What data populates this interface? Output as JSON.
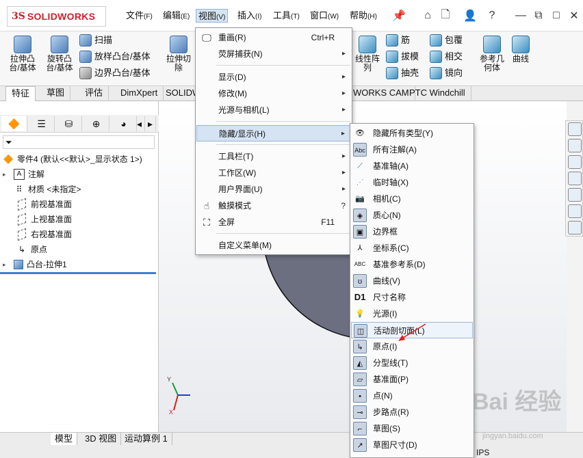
{
  "app": {
    "logo_ds": "3S",
    "logo_brand": "SOLIDWORKS"
  },
  "menubar": [
    {
      "label": "文件",
      "key": "(F)"
    },
    {
      "label": "编辑",
      "key": "(E)"
    },
    {
      "label": "视图",
      "key": "(V)"
    },
    {
      "label": "插入",
      "key": "(I)"
    },
    {
      "label": "工具",
      "key": "(T)"
    },
    {
      "label": "窗口",
      "key": "(W)"
    },
    {
      "label": "帮助",
      "key": "(H)"
    }
  ],
  "command_manager": {
    "extrude_boss": "拉伸凸\n台/基体",
    "revolve_boss": "旋转凸\n台/基体",
    "sweep": "扫描",
    "loft": "放样凸台/基体",
    "boundary": "边界凸台/基体",
    "extrude_cut": "拉伸切\n除",
    "linear_pattern": "线性阵\n列",
    "rib": "筋",
    "draft": "拔模",
    "shell": "抽壳",
    "wrap": "包覆",
    "intersect": "相交",
    "mirror": "镜向",
    "ref_geometry": "参考几\n何体",
    "curves": "曲线"
  },
  "tabs": [
    "特征",
    "草图",
    "评估",
    "DimXpert",
    "SOLIDW",
    "WORKS CAM",
    "PTC Windchill"
  ],
  "tree": {
    "part": "零件4 (默认<<默认>_显示状态 1>)",
    "items": [
      "注解",
      "材质 <未指定>",
      "前视基准面",
      "上视基准面",
      "右视基准面",
      "原点",
      "凸台-拉伸1"
    ]
  },
  "view_menu": [
    {
      "label": "重画(R)",
      "shortcut": "Ctrl+R",
      "submenu": false
    },
    {
      "label": "荧屏捕获(N)",
      "shortcut": "",
      "submenu": true
    },
    {
      "label": "显示(D)",
      "shortcut": "",
      "submenu": true
    },
    {
      "label": "修改(M)",
      "shortcut": "",
      "submenu": true
    },
    {
      "label": "光源与相机(L)",
      "shortcut": "",
      "submenu": true
    },
    {
      "label": "隐藏/显示(H)",
      "shortcut": "",
      "submenu": true
    },
    {
      "label": "工具栏(T)",
      "shortcut": "",
      "submenu": true
    },
    {
      "label": "工作区(W)",
      "shortcut": "",
      "submenu": true
    },
    {
      "label": "用户界面(U)",
      "shortcut": "",
      "submenu": true
    },
    {
      "label": "触摸模式",
      "shortcut": "",
      "submenu": false
    },
    {
      "label": "全屏",
      "shortcut": "F11",
      "submenu": false
    },
    {
      "label": "自定义菜单(M)",
      "shortcut": "",
      "submenu": false
    }
  ],
  "hide_show_menu": [
    {
      "label": "隐藏所有类型(Y)",
      "icon": "eye-icon"
    },
    {
      "label": "所有注解(A)",
      "icon": "annotation-icon",
      "icon_text": "Abc"
    },
    {
      "label": "基准轴(A)",
      "icon": "axis-icon"
    },
    {
      "label": "临时轴(X)",
      "icon": "temp-axis-icon"
    },
    {
      "label": "相机(C)",
      "icon": "camera-icon"
    },
    {
      "label": "质心(N)",
      "icon": "center-of-mass-icon"
    },
    {
      "label": "边界框",
      "icon": "bounding-box-icon"
    },
    {
      "label": "坐标系(C)",
      "icon": "coordinate-system-icon"
    },
    {
      "label": "基准参考系(D)",
      "icon": "datum-ref-icon"
    },
    {
      "label": "曲线(V)",
      "icon": "curve-icon"
    },
    {
      "label": "尺寸名称",
      "icon": "dimension-name-icon",
      "icon_text": "D1"
    },
    {
      "label": "光源(I)",
      "icon": "light-icon"
    },
    {
      "label": "活动剖切面(L)",
      "icon": "section-plane-icon"
    },
    {
      "label": "原点(I)",
      "icon": "origin-icon"
    },
    {
      "label": "分型线(T)",
      "icon": "parting-line-icon"
    },
    {
      "label": "基准面(P)",
      "icon": "plane-icon"
    },
    {
      "label": "点(N)",
      "icon": "point-icon"
    },
    {
      "label": "步路点(R)",
      "icon": "route-point-icon"
    },
    {
      "label": "草图(S)",
      "icon": "sketch-icon"
    },
    {
      "label": "草图尺寸(D)",
      "icon": "sketch-dimension-icon"
    }
  ],
  "bottom_tabs": [
    "模型",
    "3D 视图",
    "运动算例 1"
  ],
  "status": {
    "units": "IPS"
  },
  "watermark": {
    "text": "Bai 经验",
    "sub": "jingyan.baidu.com"
  }
}
